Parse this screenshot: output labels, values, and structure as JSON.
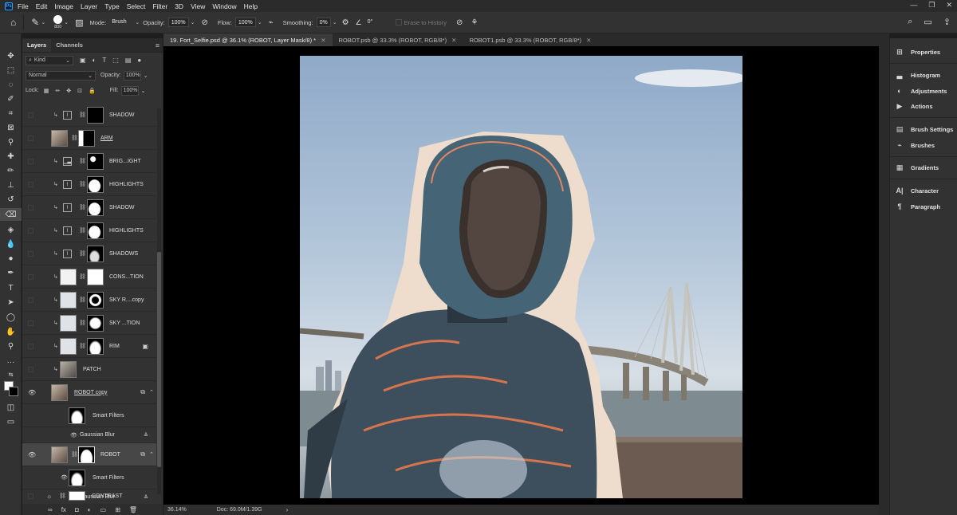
{
  "menubar": {
    "items": [
      "File",
      "Edit",
      "Image",
      "Layer",
      "Type",
      "Select",
      "Filter",
      "3D",
      "View",
      "Window",
      "Help"
    ]
  },
  "options": {
    "brush_size": "800",
    "mode_label": "Mode:",
    "mode_value": "Brush",
    "opacity_label": "Opacity:",
    "opacity_value": "100%",
    "flow_label": "Flow:",
    "flow_value": "100%",
    "smoothing_label": "Smoothing:",
    "smoothing_value": "0%",
    "angle_value": "0°",
    "erase_history_label": "Erase to History"
  },
  "layers_panel": {
    "tab_layers": "Layers",
    "tab_channels": "Channels",
    "kind_label": "Kind",
    "blend_mode": "Normal",
    "opacity_label": "Opacity:",
    "opacity_value": "100%",
    "lock_label": "Lock:",
    "fill_label": "Fill:",
    "fill_value": "100%",
    "layers": [
      {
        "name": "SHADOW",
        "visible": false,
        "type": "adjustment",
        "mask": "black"
      },
      {
        "name": "ARM",
        "visible": false,
        "type": "pixel",
        "mask": "arm"
      },
      {
        "name": "BRIG...IGHT",
        "visible": false,
        "type": "adjustment",
        "mask": "black-dot"
      },
      {
        "name": "HIGHLIGHTS",
        "visible": false,
        "type": "adjustment",
        "mask": "figure"
      },
      {
        "name": "SHADOW",
        "visible": false,
        "type": "adjustment",
        "mask": "figure"
      },
      {
        "name": "HIGHLIGHTS",
        "visible": false,
        "type": "adjustment",
        "mask": "figure"
      },
      {
        "name": "SHADOWS",
        "visible": false,
        "type": "adjustment",
        "mask": "figure-dark"
      },
      {
        "name": "CONS...TION",
        "visible": false,
        "type": "pixel",
        "mask": "white"
      },
      {
        "name": "SKY R....copy",
        "visible": false,
        "type": "pixel",
        "mask": "ring"
      },
      {
        "name": "SKY ...TION",
        "visible": false,
        "type": "pixel",
        "mask": "ring"
      },
      {
        "name": "RIM",
        "visible": false,
        "type": "pixel",
        "mask": "figure"
      },
      {
        "name": "PATCH",
        "visible": false,
        "type": "pixel",
        "mask": "none"
      },
      {
        "name": "ROBOT copy",
        "visible": true,
        "type": "smart",
        "mask": "none"
      },
      {
        "name": "Smart Filters",
        "visible": false,
        "type": "filter-mask"
      },
      {
        "name": "Gaussian Blur",
        "visible": false,
        "type": "filter"
      },
      {
        "name": "ROBOT",
        "visible": true,
        "type": "smart",
        "mask": "figure",
        "selected": true
      },
      {
        "name": "Smart Filters",
        "visible": true,
        "type": "filter-mask"
      },
      {
        "name": "Gaussian Blur",
        "visible": false,
        "type": "filter"
      },
      {
        "name": "CONTRAST",
        "visible": false,
        "type": "adjustment",
        "mask": "white"
      }
    ]
  },
  "doc_tabs": [
    {
      "label": "19. Fort_Selfie.psd @ 36.1% (ROBOT, Layer Mask/8) *",
      "active": true
    },
    {
      "label": "ROBOT.psb @ 33.3% (ROBOT, RGB/8*)",
      "active": false
    },
    {
      "label": "ROBOT1.psb @ 33.3% (ROBOT, RGB/8*)",
      "active": false
    }
  ],
  "status": {
    "zoom": "36.14%",
    "doc_size": "Doc: 69.0M/1.39G"
  },
  "right_panels": [
    {
      "label": "Properties",
      "icon": "properties-icon"
    },
    {
      "label": "Histogram",
      "icon": "histogram-icon"
    },
    {
      "label": "Adjustments",
      "icon": "adjustments-icon"
    },
    {
      "label": "Actions",
      "icon": "actions-icon"
    },
    {
      "label": "Brush Settings",
      "icon": "brush-settings-icon"
    },
    {
      "label": "Brushes",
      "icon": "brushes-icon"
    },
    {
      "label": "Gradients",
      "icon": "gradients-icon"
    },
    {
      "label": "Character",
      "icon": "character-icon"
    },
    {
      "label": "Paragraph",
      "icon": "paragraph-icon"
    }
  ],
  "colors": {
    "foreground": "#ffffff",
    "background": "#000000",
    "accent": "#2fa3ff"
  }
}
